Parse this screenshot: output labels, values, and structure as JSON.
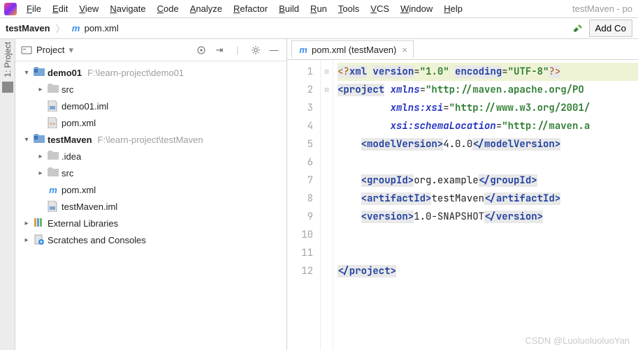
{
  "window": {
    "title_suffix": "testMaven - po"
  },
  "menu": {
    "items": [
      "File",
      "Edit",
      "View",
      "Navigate",
      "Code",
      "Analyze",
      "Refactor",
      "Build",
      "Run",
      "Tools",
      "VCS",
      "Window",
      "Help"
    ]
  },
  "breadcrumb": {
    "project": "testMaven",
    "file": "pom.xml"
  },
  "toolbar": {
    "add_config": "Add Co"
  },
  "sidebar": {
    "label": "1: Project"
  },
  "project_tool": {
    "title": "Project",
    "roots": [
      {
        "name": "demo01",
        "path": "F:\\learn-project\\demo01",
        "expanded": true,
        "children": [
          {
            "name": "src",
            "type": "folder",
            "expandable": true
          },
          {
            "name": "demo01.iml",
            "type": "iml"
          },
          {
            "name": "pom.xml",
            "type": "pom"
          }
        ]
      },
      {
        "name": "testMaven",
        "path": "F:\\learn-project\\testMaven",
        "expanded": true,
        "children": [
          {
            "name": ".idea",
            "type": "folder",
            "expandable": true
          },
          {
            "name": "src",
            "type": "folder",
            "expandable": true
          },
          {
            "name": "pom.xml",
            "type": "pom-m"
          },
          {
            "name": "testMaven.iml",
            "type": "iml"
          }
        ]
      }
    ],
    "extra": [
      {
        "name": "External Libraries",
        "icon": "lib"
      },
      {
        "name": "Scratches and Consoles",
        "icon": "scratch"
      }
    ]
  },
  "editor": {
    "tab_label": "pom.xml (testMaven)",
    "lines": [
      {
        "n": 1,
        "html": "<span class='pi'>&lt;?</span><span class='tag'>xml</span> <span class='tag'>version</span>=<span class='str'>\"1.0\"</span> <span class='tag'>encoding</span>=<span class='str'>\"UTF-8\"</span><span class='pi'>?&gt;</span>",
        "hl": true,
        "fold": ""
      },
      {
        "n": 2,
        "html": "<span class='tag'>&lt;project</span> <span class='attr'>xmlns</span>=<span class='str'>\"http://maven.apache.org/PO</span>",
        "fold": "⊟"
      },
      {
        "n": 3,
        "html": "         <span class='attr'>xmlns:xsi</span>=<span class='str'>\"http://www.w3.org/2001/</span>",
        "fold": ""
      },
      {
        "n": 4,
        "html": "         <span class='attr'>xsi:schemaLocation</span>=<span class='str'>\"http://maven.a</span>",
        "fold": ""
      },
      {
        "n": 5,
        "html": "    <span class='tag'>&lt;modelVersion&gt;</span><span class='txt'>4.0.0</span><span class='tag'>&lt;/modelVersion&gt;</span>",
        "fold": ""
      },
      {
        "n": 6,
        "html": "",
        "fold": ""
      },
      {
        "n": 7,
        "html": "    <span class='tag'>&lt;groupId&gt;</span><span class='txt'>org.example</span><span class='tag'>&lt;/groupId&gt;</span>",
        "fold": ""
      },
      {
        "n": 8,
        "html": "    <span class='tag'>&lt;artifactId&gt;</span><span class='txt'>testMaven</span><span class='tag'>&lt;/artifactId&gt;</span>",
        "fold": ""
      },
      {
        "n": 9,
        "html": "    <span class='tag'>&lt;version&gt;</span><span class='txt'>1.0-SNAPSHOT</span><span class='tag'>&lt;/version&gt;</span>",
        "fold": ""
      },
      {
        "n": 10,
        "html": "",
        "fold": ""
      },
      {
        "n": 11,
        "html": "",
        "fold": ""
      },
      {
        "n": 12,
        "html": "<span class='tag'>&lt;/project&gt;</span>",
        "fold": "⊟"
      }
    ]
  },
  "watermark": "CSDN @LuoluoluoluoYan"
}
